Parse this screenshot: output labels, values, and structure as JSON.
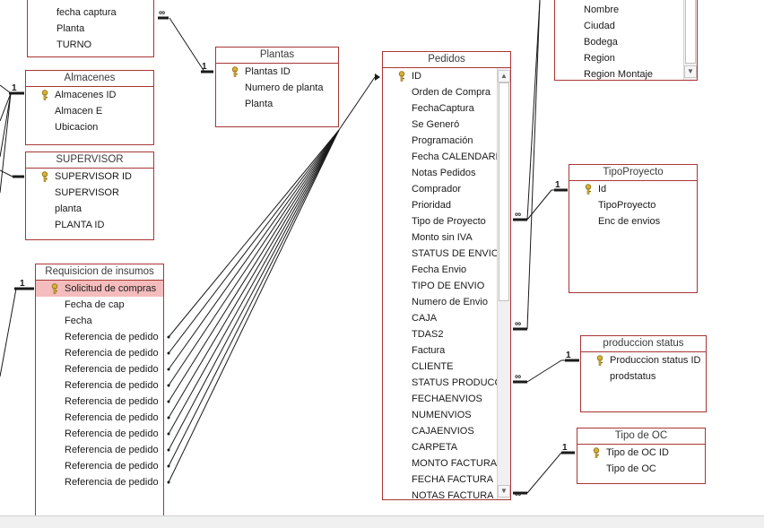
{
  "relationship_labels": {
    "one": "1",
    "many": "∞"
  },
  "tables": {
    "top_partial": {
      "fields": [
        "fecha captura",
        "Planta",
        "TURNO"
      ]
    },
    "plantas": {
      "title": "Plantas",
      "fields": [
        "Plantas ID",
        "Numero de planta",
        "Planta"
      ]
    },
    "almacenes": {
      "title": "Almacenes",
      "fields": [
        "Almacenes ID",
        "Almacen E",
        "Ubicacion"
      ]
    },
    "supervisor": {
      "title": "SUPERVISOR",
      "fields": [
        "SUPERVISOR ID",
        "SUPERVISOR",
        "planta",
        "PLANTA ID"
      ]
    },
    "requisicion": {
      "title": "Requisicion de insumos",
      "fields": [
        "Solicitud de compras",
        "Fecha de cap",
        "Fecha",
        "Referencia de pedido",
        "Referencia de pedido",
        "Referencia de pedido",
        "Referencia de pedido",
        "Referencia de pedido",
        "Referencia de pedido",
        "Referencia de pedido",
        "Referencia de pedido",
        "Referencia de pedido",
        "Referencia de pedido"
      ]
    },
    "pedidos": {
      "title": "Pedidos",
      "fields": [
        "ID",
        "Orden de Compra",
        "FechaCaptura",
        "Se Generó",
        "Programación",
        "Fecha CALENDARIO",
        "Notas Pedidos",
        "Comprador",
        "Prioridad",
        "Tipo de Proyecto",
        "Monto sin IVA",
        "STATUS DE ENVIO",
        "Fecha Envio",
        "TIPO DE ENVIO",
        "Numero de Envio",
        "CAJA",
        "TDAS2",
        "Factura",
        "CLIENTE",
        "STATUS PRODUCCION",
        "FECHAENVIOS",
        "NUMENVIOS",
        "CAJAENVIOS",
        "CARPETA",
        "MONTO FACTURA",
        "FECHA FACTURA",
        "NOTAS FACTURA"
      ]
    },
    "cliente_partial": {
      "fields": [
        "Nombre",
        "Ciudad",
        "Bodega",
        "Region",
        "Region Montaje"
      ]
    },
    "tipoproyecto": {
      "title": "TipoProyecto",
      "fields": [
        "Id",
        "TipoProyecto",
        "Enc de envios"
      ]
    },
    "produccion": {
      "title": "produccion status",
      "fields": [
        "Produccion status ID",
        "prodstatus"
      ]
    },
    "tipooc": {
      "title": "Tipo de OC",
      "fields": [
        "Tipo de OC ID",
        "Tipo de OC"
      ]
    }
  },
  "colors": {
    "table_border": "#a93535",
    "selected_field": "#f4bcbc",
    "relationship_line": "#1a1a1a",
    "key_icon": "#d8b13a"
  },
  "icons": {
    "primary_key": "key-icon",
    "scroll_up": "scroll-up-icon",
    "scroll_down": "scroll-down-icon"
  }
}
